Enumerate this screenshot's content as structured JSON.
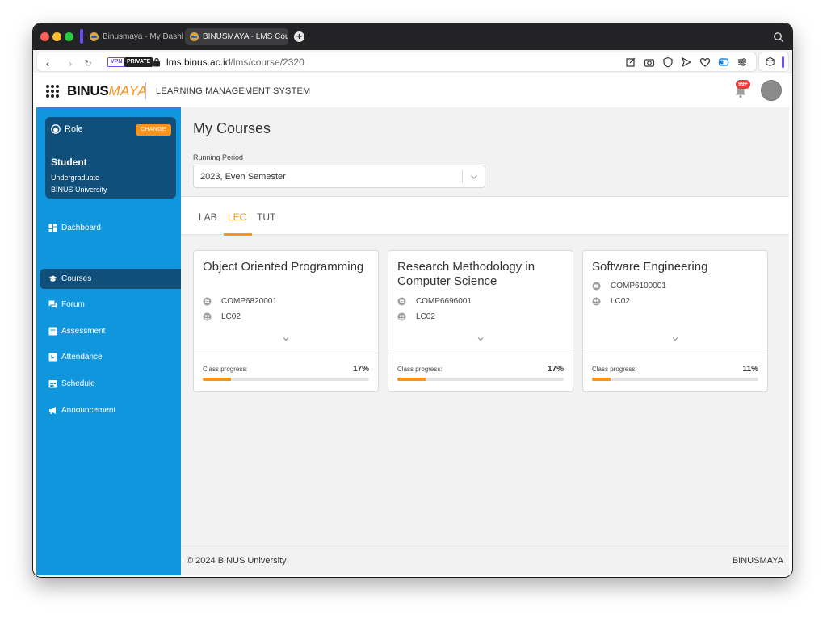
{
  "browser": {
    "tabs": [
      {
        "title": "Binusmaya - My Dashbo"
      },
      {
        "title": "BINUSMAYA - LMS Cour"
      }
    ],
    "badges": {
      "vpn": "VPN",
      "private": "PRIVATE"
    },
    "url_host": "lms.binus.ac.id",
    "url_path": "/lms/course/2320",
    "accent": "#6c4cf1"
  },
  "header": {
    "logo_binus": "BINUS",
    "logo_maya": "MAYA",
    "subtitle": "LEARNING MANAGEMENT SYSTEM",
    "notification_count": "99+"
  },
  "sidebar": {
    "role_label": "Role",
    "change_label": "CHANGE",
    "role_name": "Student",
    "role_level": "Undergraduate",
    "role_org": "BINUS University",
    "items": [
      {
        "label": "Dashboard",
        "icon": "dashboard-icon"
      },
      {
        "label": "Courses",
        "icon": "graduation-cap-icon"
      },
      {
        "label": "Forum",
        "icon": "forum-icon"
      },
      {
        "label": "Assessment",
        "icon": "assessment-icon"
      },
      {
        "label": "Attendance",
        "icon": "attendance-icon"
      },
      {
        "label": "Schedule",
        "icon": "calendar-icon"
      },
      {
        "label": "Announcement",
        "icon": "megaphone-icon"
      }
    ],
    "active_item": "Courses",
    "color": "#0f96dc",
    "active_color": "#0f4f79"
  },
  "main": {
    "title": "My Courses",
    "period_label": "Running Period",
    "period_value": "2023, Even Semester",
    "tabs": [
      {
        "label": "LAB"
      },
      {
        "label": "LEC"
      },
      {
        "label": "TUT"
      }
    ],
    "active_tab": "LEC",
    "accent": "#f7941d",
    "courses": [
      {
        "title": "Object Oriented Programming",
        "code": "COMP6820001",
        "class": "LC02",
        "progress_label": "Class progress:",
        "progress": "17%"
      },
      {
        "title": "Research Methodology in Computer Science",
        "code": "COMP6696001",
        "class": "LC02",
        "progress_label": "Class progress:",
        "progress": "17%"
      },
      {
        "title": "Software Engineering",
        "code": "COMP6100001",
        "class": "LC02",
        "progress_label": "Class progress:",
        "progress": "11%"
      }
    ]
  },
  "footer": {
    "copyright": "© 2024 BINUS University",
    "brand": "BINUSMAYA"
  }
}
